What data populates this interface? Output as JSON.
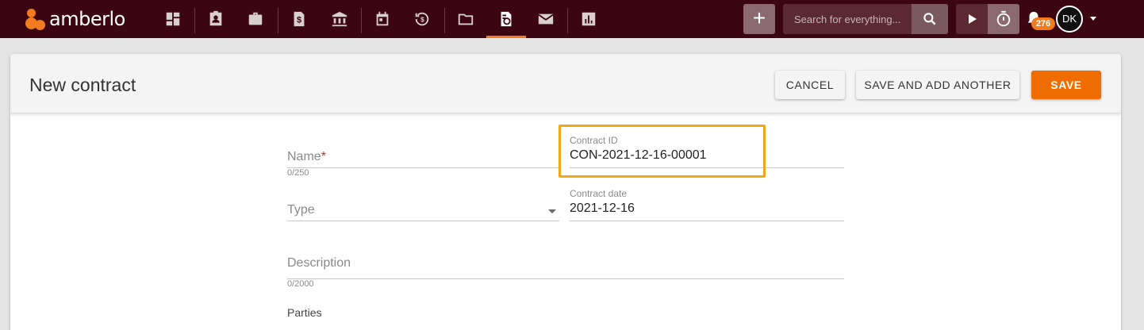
{
  "app": {
    "brand": "amberlo",
    "accent_color": "#f07c1f",
    "topbar_color": "#3b0511"
  },
  "nav": {
    "items": [
      {
        "name": "dashboard-icon"
      },
      {
        "name": "contacts-icon"
      },
      {
        "name": "briefcase-icon"
      },
      {
        "name": "billing-icon"
      },
      {
        "name": "bank-icon"
      },
      {
        "name": "calendar-icon"
      },
      {
        "name": "time-history-icon"
      },
      {
        "name": "folder-icon"
      },
      {
        "name": "contract-document-icon",
        "active": true
      },
      {
        "name": "mail-icon"
      },
      {
        "name": "reports-icon"
      }
    ]
  },
  "toolbar": {
    "add_label": "+",
    "search_placeholder": "Search for everything...",
    "notifications_count": "276",
    "avatar_initials": "DK"
  },
  "page": {
    "title": "New contract",
    "cancel_label": "CANCEL",
    "save_and_add_label": "SAVE AND ADD ANOTHER",
    "save_label": "SAVE"
  },
  "form": {
    "name": {
      "placeholder": "Name",
      "required_mark": "*",
      "counter": "0/250"
    },
    "contract_id": {
      "label": "Contract ID",
      "value": "CON-2021-12-16-00001"
    },
    "type": {
      "placeholder": "Type"
    },
    "contract_date": {
      "label": "Contract date",
      "value": "2021-12-16"
    },
    "description": {
      "placeholder": "Description",
      "counter": "0/2000"
    },
    "parties_label": "Parties"
  }
}
